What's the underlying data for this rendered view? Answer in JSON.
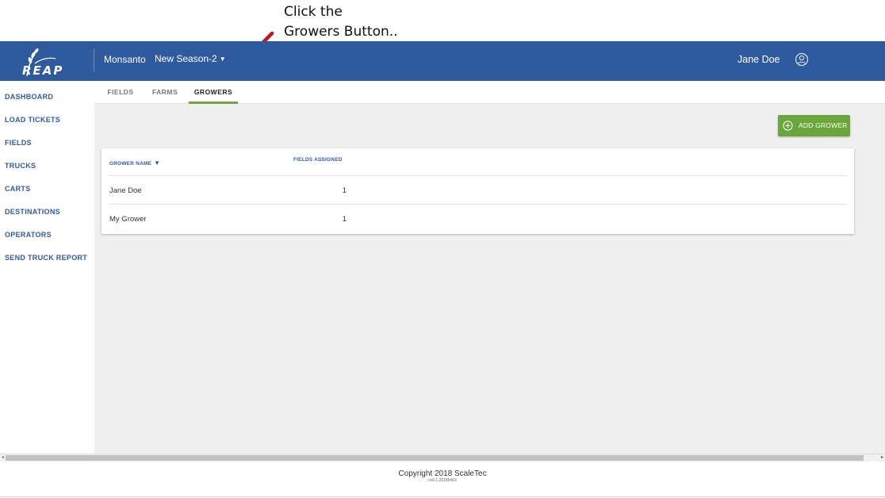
{
  "annotation": {
    "text": "Click the\nGrowers Button.."
  },
  "header": {
    "brand": "REAP",
    "organization": "Monsanto",
    "season": "New Season-2",
    "user_name": "Jane Doe"
  },
  "sidebar": {
    "items": [
      {
        "label": "DASHBOARD"
      },
      {
        "label": "LOAD TICKETS"
      },
      {
        "label": "FIELDS"
      },
      {
        "label": "TRUCKS"
      },
      {
        "label": "CARTS"
      },
      {
        "label": "DESTINATIONS"
      },
      {
        "label": "OPERATORS"
      },
      {
        "label": "SEND TRUCK REPORT"
      }
    ]
  },
  "tabs": [
    {
      "label": "FIELDS",
      "active": false
    },
    {
      "label": "FARMS",
      "active": false
    },
    {
      "label": "GROWERS",
      "active": true
    }
  ],
  "actions": {
    "add_grower": "ADD GROWER"
  },
  "table": {
    "columns": {
      "name": "GROWER NAME",
      "fields": "FIELDS ASSIGNED"
    },
    "sort": "descending",
    "rows": [
      {
        "name": "Jane Doe",
        "fields_assigned": "1"
      },
      {
        "name": "My Grower",
        "fields_assigned": "1"
      }
    ]
  },
  "footer": {
    "copyright": "Copyright 2018 ScaleTec",
    "version": "vv0.1.20180403"
  },
  "colors": {
    "header": "#2f5a9e",
    "accent": "#6aa63c",
    "link": "#2f5a9e",
    "arrow": "#c0171e"
  }
}
